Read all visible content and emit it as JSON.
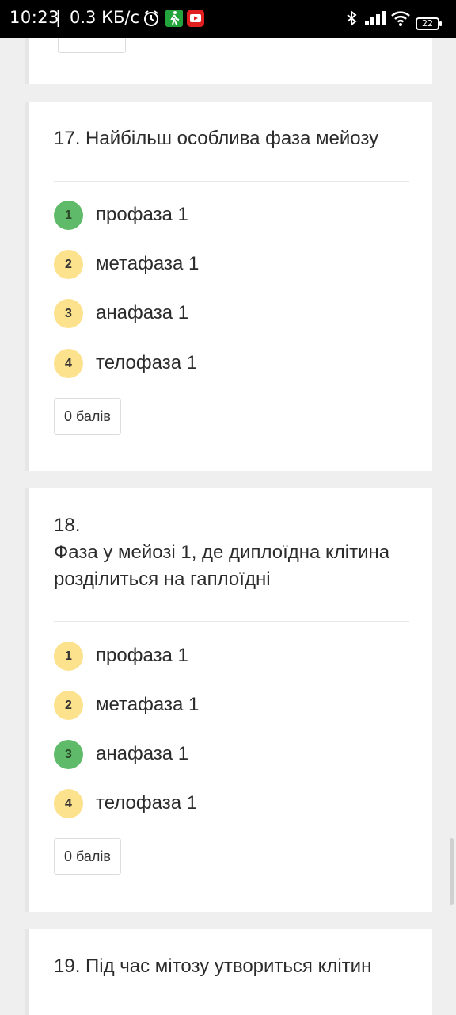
{
  "status_bar": {
    "time": "10:23",
    "separator": "|",
    "speed": "0.3 КБ/с",
    "battery": "22",
    "icons": [
      "alarm-icon",
      "walk-icon",
      "youtube-icon",
      "bluetooth-icon",
      "signal-icon",
      "wifi-icon",
      "battery-icon"
    ]
  },
  "questions": [
    {
      "number": "17.",
      "title": "17. Найбільш особлива фаза мейозу",
      "options": [
        {
          "index": "1",
          "label": "профаза 1",
          "correct": true
        },
        {
          "index": "2",
          "label": "метафаза 1",
          "correct": false
        },
        {
          "index": "3",
          "label": "анафаза 1",
          "correct": false
        },
        {
          "index": "4",
          "label": "телофаза 1",
          "correct": false
        }
      ],
      "score": "0 балів"
    },
    {
      "number": "18.",
      "title_line1": "Фаза у мейозі 1, де диплоїдна клітина",
      "title_line2": "розділиться на гаплоїдні",
      "options": [
        {
          "index": "1",
          "label": "профаза 1",
          "correct": false
        },
        {
          "index": "2",
          "label": "метафаза 1",
          "correct": false
        },
        {
          "index": "3",
          "label": "анафаза 1",
          "correct": true
        },
        {
          "index": "4",
          "label": "телофаза 1",
          "correct": false
        }
      ],
      "score": "0 балів"
    },
    {
      "number": "19.",
      "title": "19. Під час мітозу утвориться клітин"
    }
  ],
  "colors": {
    "correct": "#5fba6a",
    "option_badge": "#fde28d",
    "background": "#efefef"
  }
}
